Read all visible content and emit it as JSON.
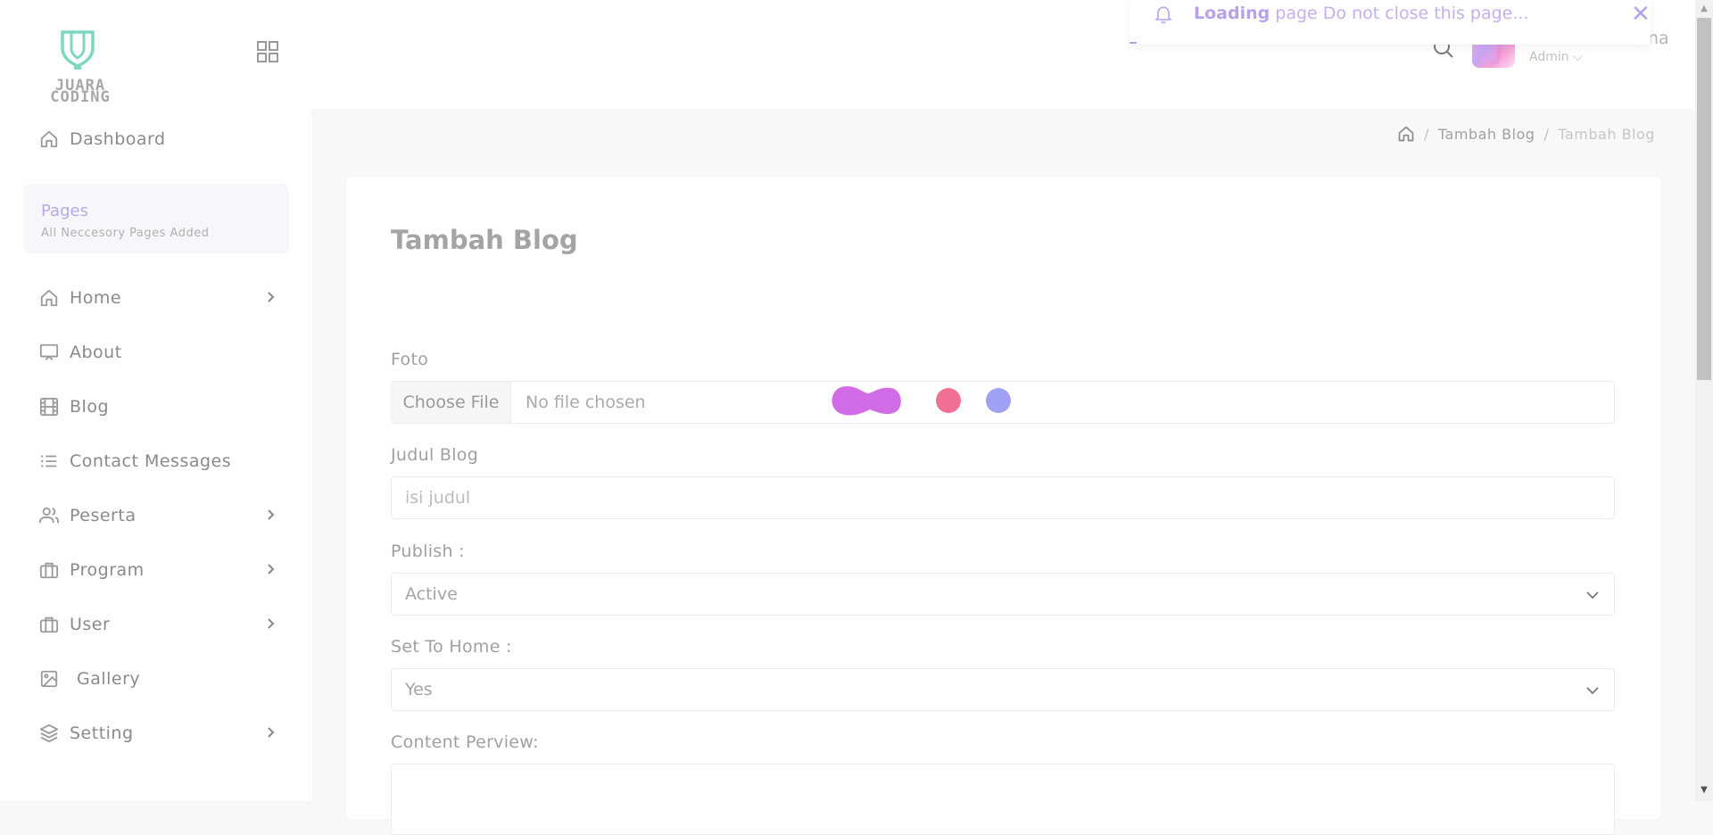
{
  "brand": {
    "logo_text_1": "JUARA",
    "logo_text_2": "CODING",
    "accent": "#b7a1ea",
    "logo_color": "#7dd8c2"
  },
  "sidebar": {
    "dashboard_label": "Dashboard",
    "pages_title": "Pages",
    "pages_subtitle": "All Neccesory Pages Added",
    "items": [
      {
        "label": "Home",
        "icon": "home-icon",
        "has_children": true
      },
      {
        "label": "About",
        "icon": "monitor-icon",
        "has_children": false
      },
      {
        "label": "Blog",
        "icon": "film-icon",
        "has_children": false
      },
      {
        "label": "Contact Messages",
        "icon": "list-icon",
        "has_children": false
      },
      {
        "label": "Peserta",
        "icon": "users-icon",
        "has_children": true
      },
      {
        "label": "Program",
        "icon": "briefcase-icon",
        "has_children": true
      },
      {
        "label": "User",
        "icon": "briefcase-icon",
        "has_children": true
      },
      {
        "label": "Gallery",
        "icon": "image-icon",
        "has_children": false
      },
      {
        "label": "Setting",
        "icon": "layers-icon",
        "has_children": true
      }
    ]
  },
  "header": {
    "user_name": "husaini al banna",
    "user_role": "Admin ⌵"
  },
  "toast": {
    "bold": "Loading",
    "message": "page Do not close this page...",
    "close": "✕"
  },
  "breadcrumb": {
    "item_1": "Tambah Blog",
    "item_2": "Tambah Blog",
    "sep": "/"
  },
  "form": {
    "title": "Tambah Blog",
    "foto_label": "Foto",
    "file_button": "Choose File",
    "file_status": "No file chosen",
    "judul_label": "Judul Blog",
    "judul_placeholder": "isi judul",
    "publish_label": "Publish :",
    "publish_value": "Active",
    "home_label": "Set To Home :",
    "home_value": "Yes",
    "content_label": "Content Perview:"
  },
  "loader_colors": {
    "blob": "#d26ce6",
    "red": "#f07094",
    "blue": "#a0a0f4"
  }
}
